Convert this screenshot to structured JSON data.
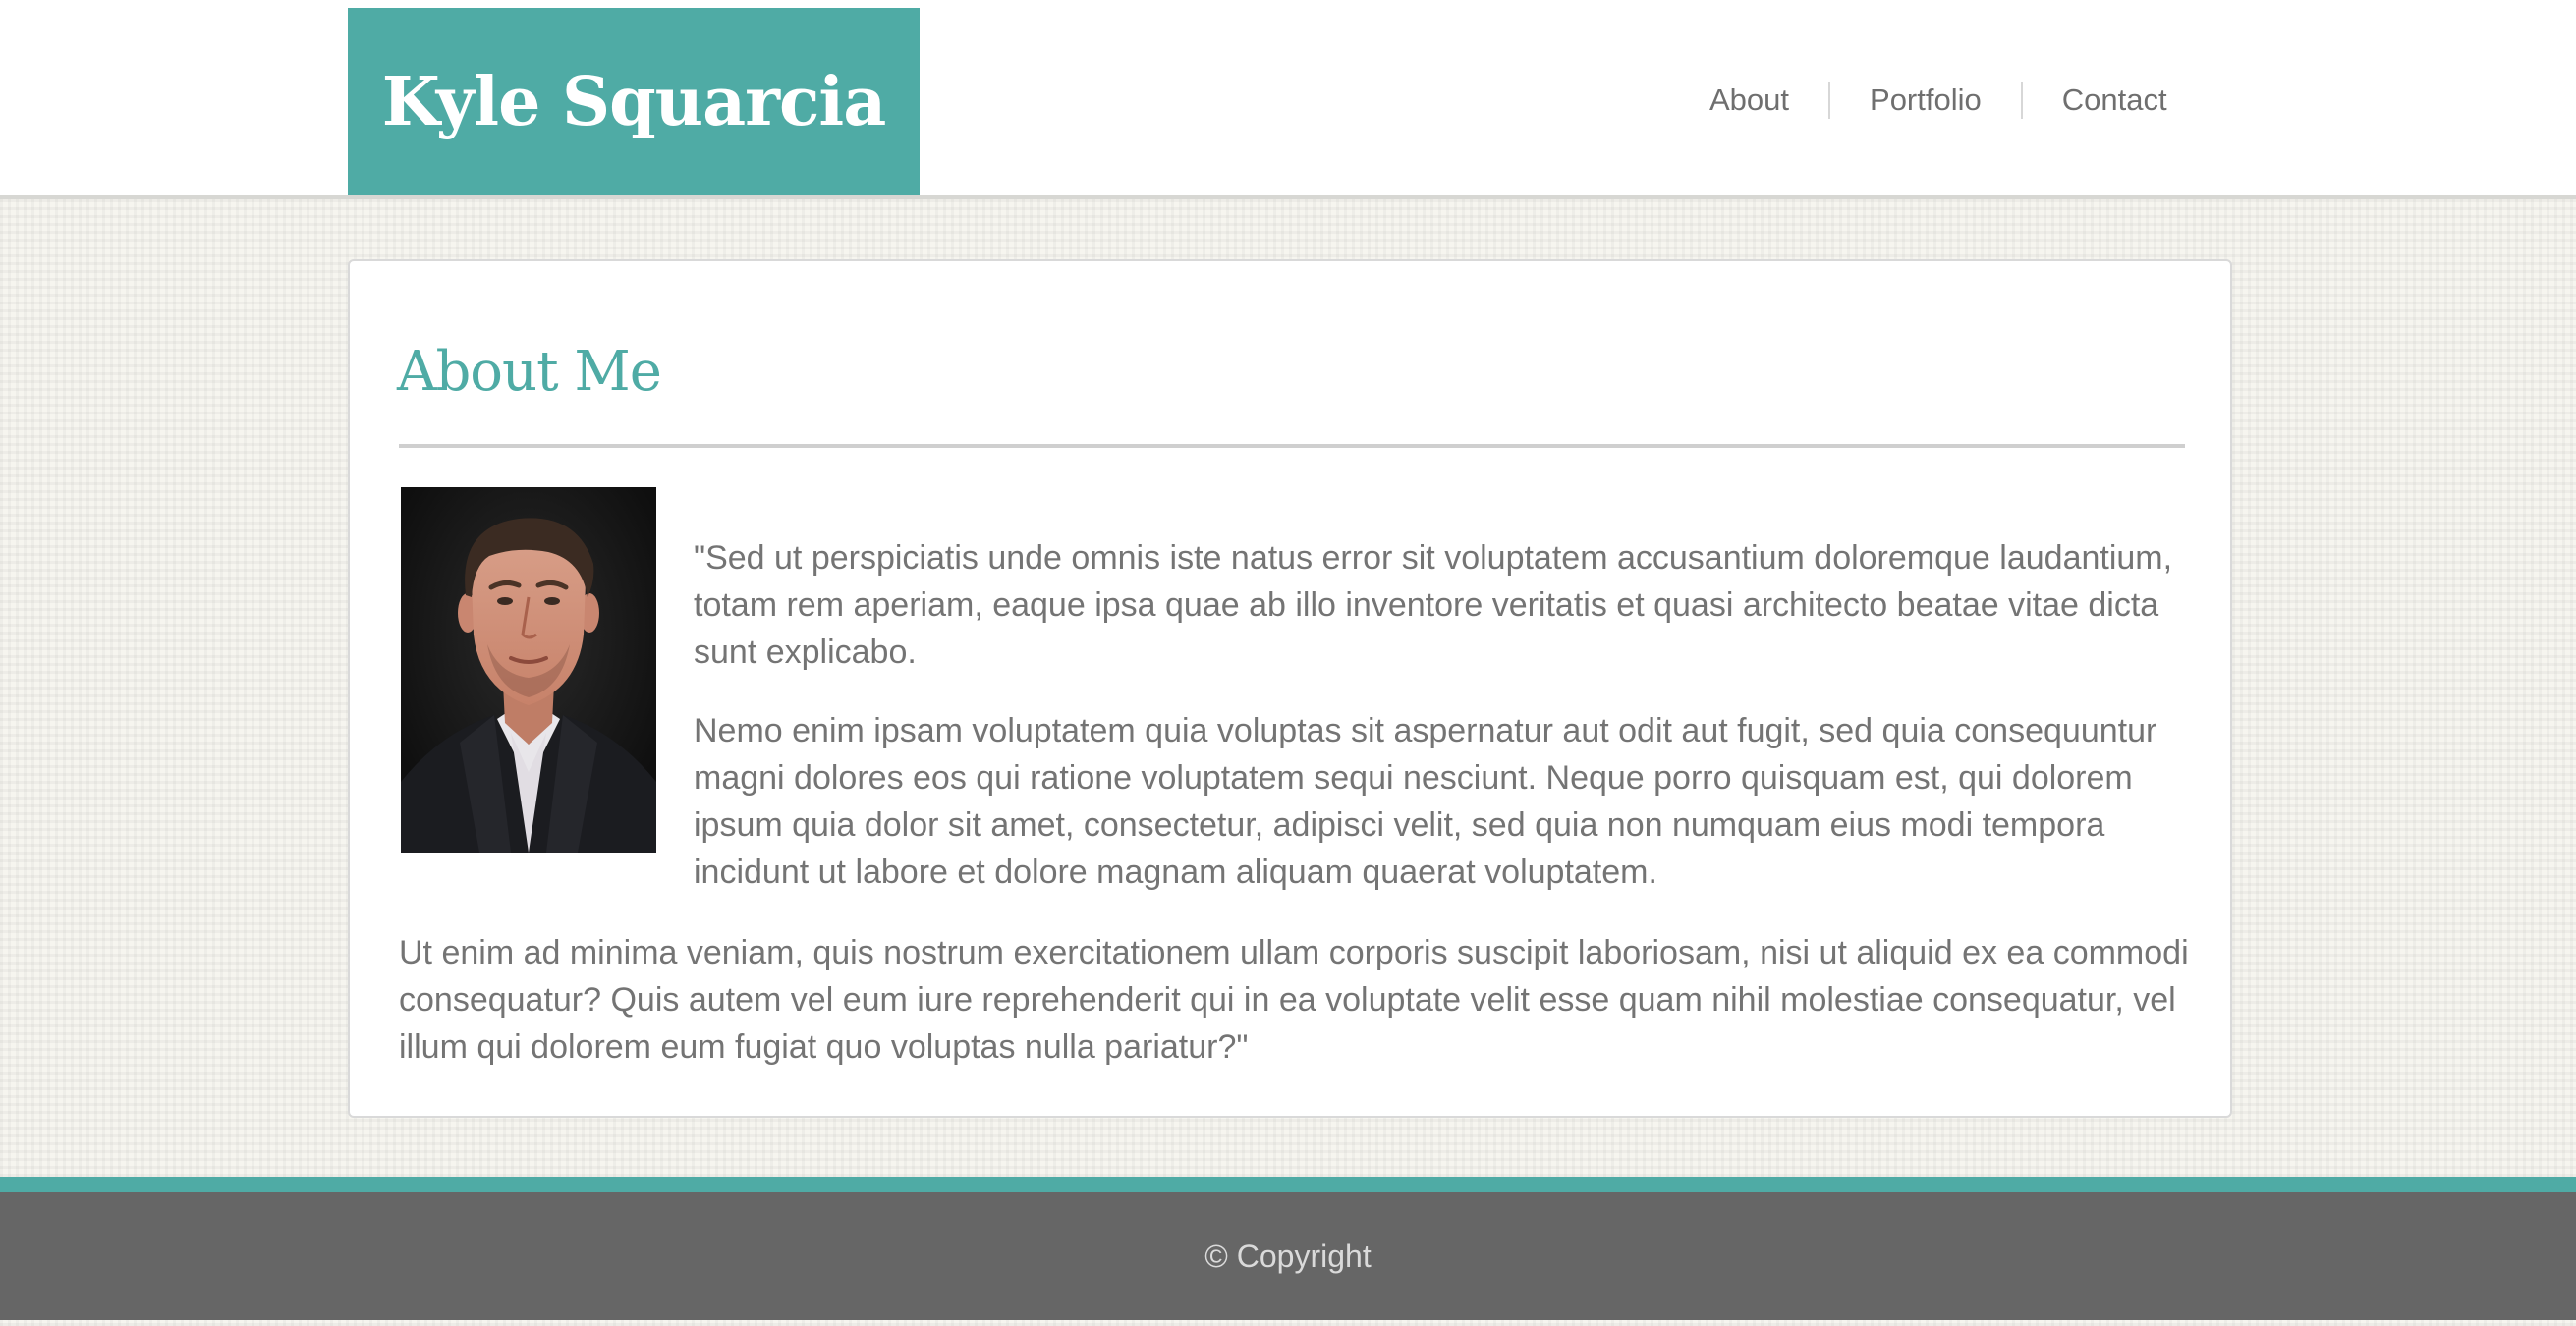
{
  "header": {
    "brand_name": "Kyle Squarcia",
    "nav": [
      {
        "label": "About"
      },
      {
        "label": "Portfolio"
      },
      {
        "label": "Contact"
      }
    ]
  },
  "main": {
    "title": "About Me",
    "portrait_alt": "portrait photo",
    "paragraphs": [
      "\"Sed ut perspiciatis unde omnis iste natus error sit voluptatem accusantium doloremque laudantium, totam rem aperiam, eaque ipsa quae ab illo inventore veritatis et quasi architecto beatae vitae dicta sunt explicabo.",
      "Nemo enim ipsam voluptatem quia voluptas sit aspernatur aut odit aut fugit, sed quia consequuntur magni dolores eos qui ratione voluptatem sequi nesciunt. Neque porro quisquam est, qui dolorem ipsum quia dolor sit amet, consectetur, adipisci velit, sed quia non numquam eius modi tempora incidunt ut labore et dolore magnam aliquam quaerat voluptatem.",
      "Ut enim ad minima veniam, quis nostrum exercitationem ullam corporis suscipit laboriosam, nisi ut aliquid ex ea commodi consequatur? Quis autem vel eum iure reprehenderit qui in ea voluptate velit esse quam nihil molestiae consequatur, vel illum qui dolorem eum fugiat quo voluptas nulla pariatur?\""
    ]
  },
  "footer": {
    "copyright": "© Copyright"
  },
  "colors": {
    "accent": "#4faba5",
    "footer_bg": "#666666",
    "body_text": "#747474"
  }
}
